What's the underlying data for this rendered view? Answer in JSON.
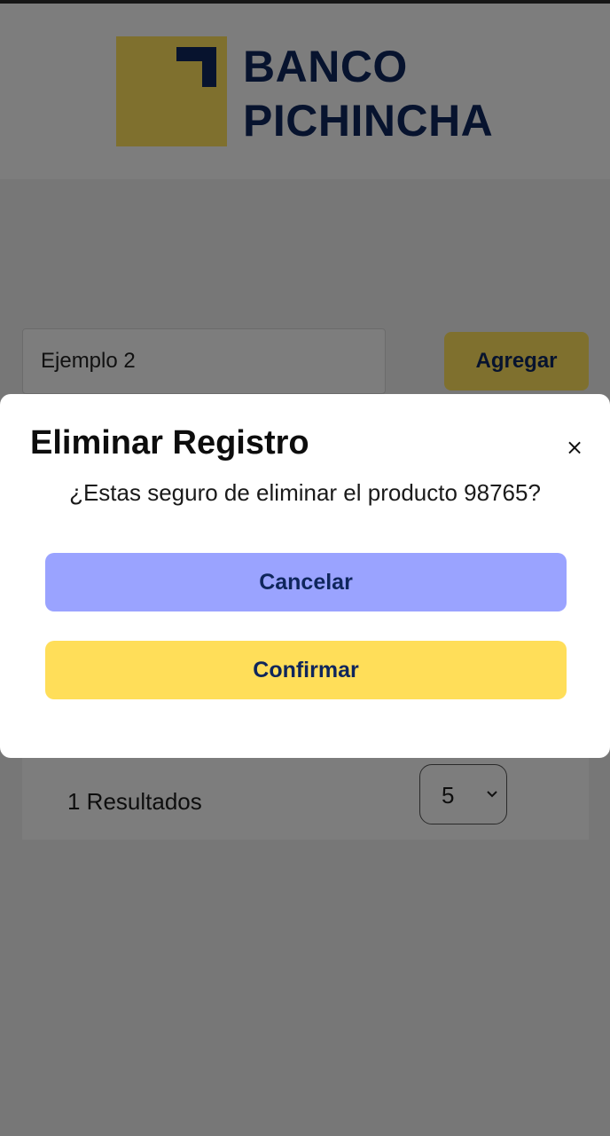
{
  "header": {
    "brand_line1": "BANCO",
    "brand_line2": "PICHINCHA",
    "logo_icon": "pichincha-logo-icon",
    "colors": {
      "brand_yellow": "#ffe05c",
      "brand_navy": "#0f265c"
    }
  },
  "toolbar": {
    "search_value": "Ejemplo 2",
    "add_label": "Agregar"
  },
  "results": {
    "count_text": "1 Resultados",
    "page_size": "5",
    "dropdown_icon": "chevron-down-icon"
  },
  "modal": {
    "title": "Eliminar Registro",
    "close_label": "×",
    "message": "¿Estas seguro de eliminar el producto 98765?",
    "cancel_label": "Cancelar",
    "confirm_label": "Confirmar",
    "colors": {
      "cancel_bg": "#9aa3ff",
      "confirm_bg": "#ffde59"
    }
  }
}
